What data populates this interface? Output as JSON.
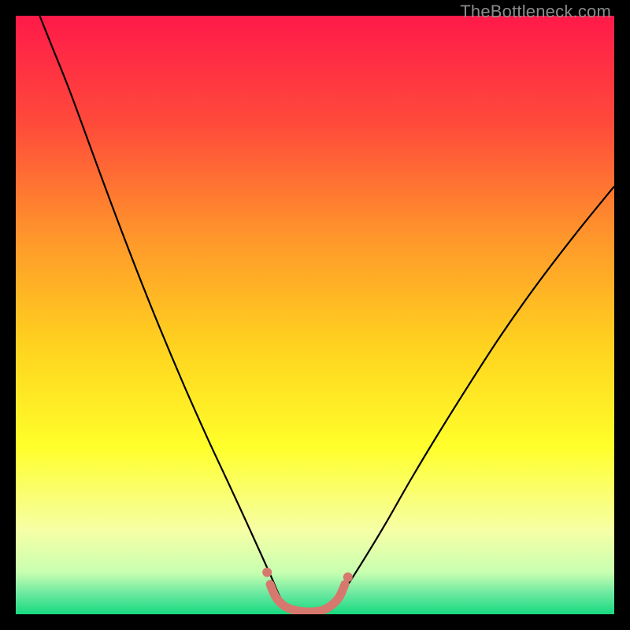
{
  "watermark": {
    "text": "TheBottleneck.com"
  },
  "chart_data": {
    "type": "line",
    "title": "",
    "xlabel": "",
    "ylabel": "",
    "xlim": [
      0,
      100
    ],
    "ylim": [
      0,
      100
    ],
    "grid": false,
    "legend": false,
    "background_gradient": {
      "stops": [
        {
          "offset": 0.0,
          "color": "#ff1a49"
        },
        {
          "offset": 0.18,
          "color": "#ff4a3b"
        },
        {
          "offset": 0.38,
          "color": "#ff9a2a"
        },
        {
          "offset": 0.55,
          "color": "#ffd21f"
        },
        {
          "offset": 0.72,
          "color": "#ffff2a"
        },
        {
          "offset": 0.86,
          "color": "#f6ffa6"
        },
        {
          "offset": 0.93,
          "color": "#c8ffb0"
        },
        {
          "offset": 0.965,
          "color": "#6de9a1"
        },
        {
          "offset": 1.0,
          "color": "#17d980"
        }
      ]
    },
    "series": [
      {
        "name": "curve-left",
        "stroke": "#000000",
        "stroke_width": 2.2,
        "type": "line",
        "points": [
          {
            "x": 4.0,
            "y": 100.0
          },
          {
            "x": 6.0,
            "y": 95.0
          },
          {
            "x": 9.0,
            "y": 87.5
          },
          {
            "x": 12.5,
            "y": 78.0
          },
          {
            "x": 16.0,
            "y": 68.5
          },
          {
            "x": 20.0,
            "y": 58.0
          },
          {
            "x": 24.0,
            "y": 48.0
          },
          {
            "x": 28.0,
            "y": 38.5
          },
          {
            "x": 32.0,
            "y": 29.5
          },
          {
            "x": 35.5,
            "y": 22.0
          },
          {
            "x": 38.5,
            "y": 15.5
          },
          {
            "x": 41.0,
            "y": 10.0
          },
          {
            "x": 42.8,
            "y": 6.0
          },
          {
            "x": 44.0,
            "y": 3.2
          },
          {
            "x": 45.0,
            "y": 1.6
          }
        ]
      },
      {
        "name": "curve-right",
        "stroke": "#000000",
        "stroke_width": 2.2,
        "type": "line",
        "points": [
          {
            "x": 53.0,
            "y": 1.6
          },
          {
            "x": 54.5,
            "y": 3.5
          },
          {
            "x": 56.5,
            "y": 6.5
          },
          {
            "x": 59.0,
            "y": 10.5
          },
          {
            "x": 62.0,
            "y": 15.5
          },
          {
            "x": 66.0,
            "y": 22.5
          },
          {
            "x": 70.5,
            "y": 30.0
          },
          {
            "x": 75.5,
            "y": 38.0
          },
          {
            "x": 81.0,
            "y": 46.5
          },
          {
            "x": 87.0,
            "y": 55.0
          },
          {
            "x": 93.5,
            "y": 63.5
          },
          {
            "x": 100.0,
            "y": 71.5
          }
        ]
      },
      {
        "name": "valley-highlight",
        "stroke": "#d7786f",
        "stroke_width": 11,
        "type": "line",
        "linecap": "round",
        "points": [
          {
            "x": 42.5,
            "y": 5.0
          },
          {
            "x": 43.5,
            "y": 2.8
          },
          {
            "x": 45.0,
            "y": 1.3
          },
          {
            "x": 47.0,
            "y": 0.6
          },
          {
            "x": 49.0,
            "y": 0.4
          },
          {
            "x": 51.0,
            "y": 0.6
          },
          {
            "x": 52.5,
            "y": 1.3
          },
          {
            "x": 54.0,
            "y": 2.8
          },
          {
            "x": 55.0,
            "y": 5.0
          }
        ]
      },
      {
        "name": "valley-marker-left",
        "type": "scatter",
        "fill": "#d7786f",
        "radius": 6,
        "points": [
          {
            "x": 42.0,
            "y": 7.0
          }
        ]
      },
      {
        "name": "valley-marker-right",
        "type": "scatter",
        "fill": "#d7786f",
        "radius": 6,
        "points": [
          {
            "x": 55.5,
            "y": 6.2
          }
        ]
      }
    ]
  }
}
